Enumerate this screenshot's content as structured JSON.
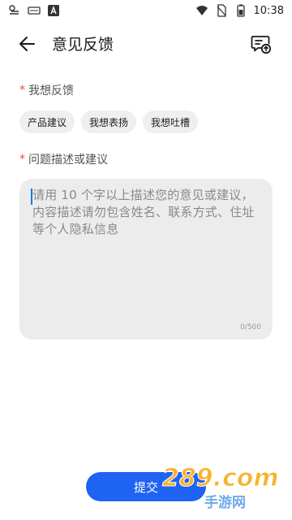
{
  "status_bar": {
    "time": "10:38",
    "left_icons": [
      "weather-icon",
      "notification-icon",
      "app-a-icon"
    ],
    "right_icons": [
      "wifi-icon",
      "no-sim-icon",
      "battery-icon"
    ]
  },
  "header": {
    "title": "意见反馈"
  },
  "feedback_type": {
    "label": "我想反馈",
    "required_mark": "*",
    "chips": [
      "产品建议",
      "我想表扬",
      "我想吐槽"
    ]
  },
  "description": {
    "label": "问题描述或建议",
    "required_mark": "*",
    "placeholder": "请用 10 个字以上描述您的意见或建议，内容描述请勿包含姓名、联系方式、住址等个人隐私信息",
    "counter": "0/500"
  },
  "submit": {
    "label": "提交",
    "color": "#1f63f2"
  },
  "watermark": {
    "text_primary": "289.com",
    "text_secondary": "手游网"
  }
}
